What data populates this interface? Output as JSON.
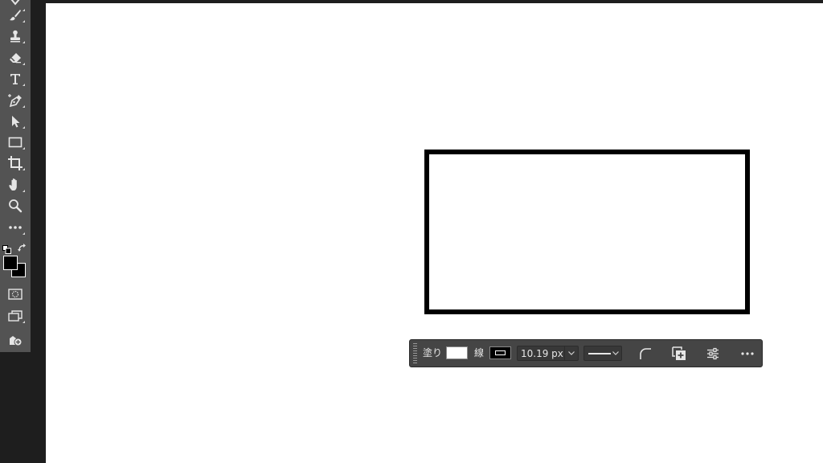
{
  "toolbar": {
    "tools": [
      {
        "name": "brush-tool",
        "icon": "brush-icon"
      },
      {
        "name": "clone-stamp-tool",
        "icon": "stamp-icon"
      },
      {
        "name": "eraser-tool",
        "icon": "eraser-icon"
      },
      {
        "name": "type-tool",
        "icon": "type-icon"
      },
      {
        "name": "pen-tool",
        "icon": "pen-icon"
      },
      {
        "name": "path-selection-tool",
        "icon": "arrow-icon"
      },
      {
        "name": "rectangle-tool",
        "icon": "rectangle-icon"
      },
      {
        "name": "crop-tool",
        "icon": "crop-icon"
      },
      {
        "name": "hand-tool",
        "icon": "hand-icon"
      },
      {
        "name": "zoom-tool",
        "icon": "magnifier-icon"
      },
      {
        "name": "edit-toolbar",
        "icon": "more-icon"
      }
    ],
    "foreground_color": "#000000",
    "background_color": "#000000"
  },
  "taskbar": {
    "fill_label": "塗り",
    "fill_color": "#ffffff",
    "stroke_label": "線",
    "stroke_color": "#000000",
    "stroke_width": "10.19 px"
  },
  "colors": {
    "ui_panel": "#535353",
    "ui_dark": "#1e1e1e",
    "canvas": "#ffffff",
    "taskbar": "#454545"
  }
}
